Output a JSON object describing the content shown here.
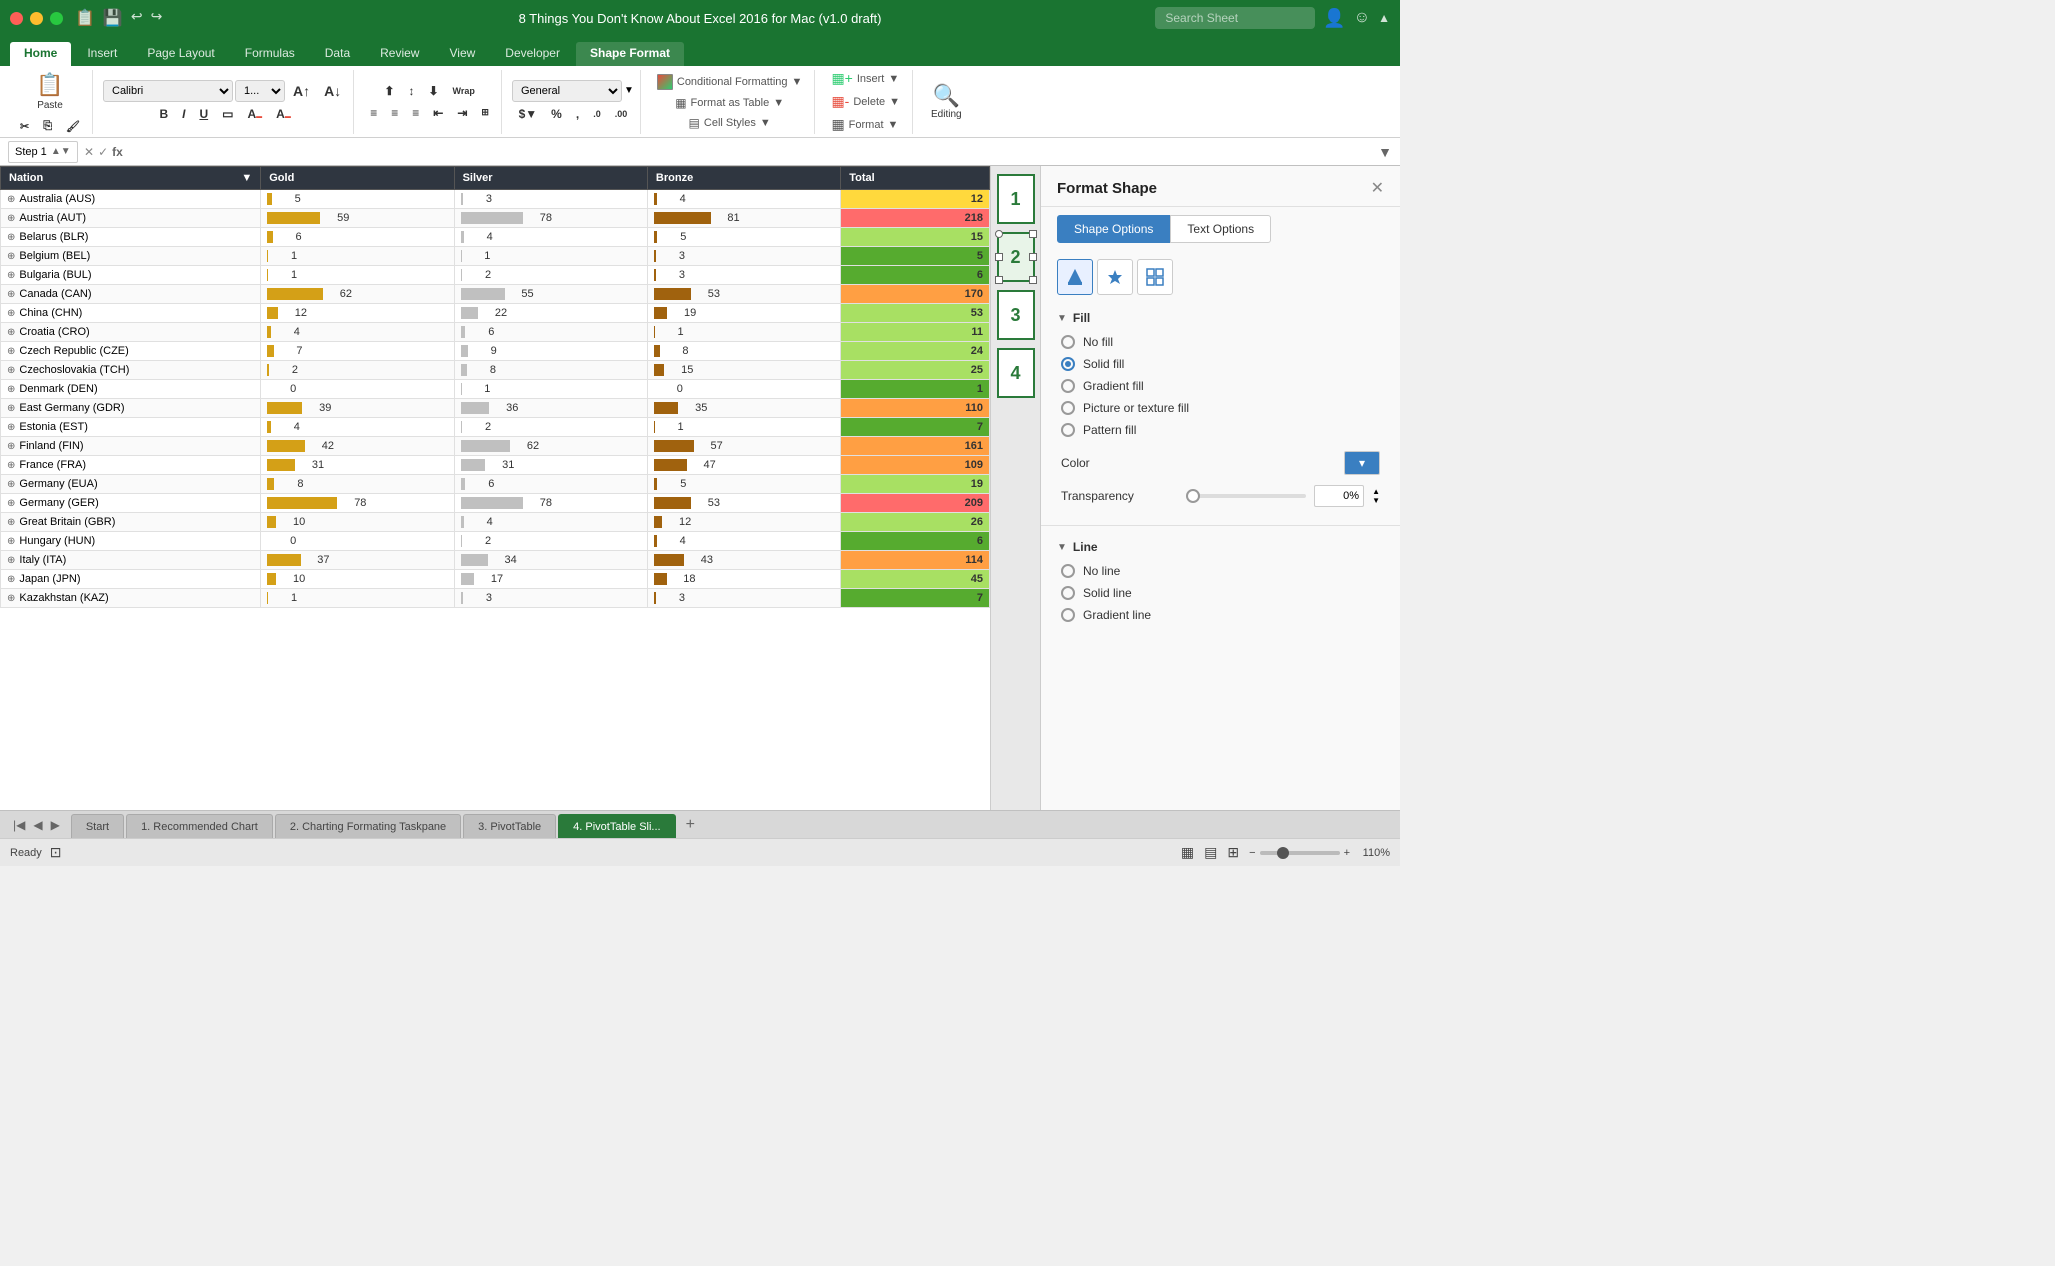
{
  "titlebar": {
    "title": "8 Things You Don't Know About Excel 2016 for Mac (v1.0 draft)",
    "search_placeholder": "Search Sheet",
    "traffic_lights": [
      "red",
      "yellow",
      "green"
    ]
  },
  "ribbon": {
    "tabs": [
      {
        "label": "Home",
        "active": true
      },
      {
        "label": "Insert",
        "active": false
      },
      {
        "label": "Page Layout",
        "active": false
      },
      {
        "label": "Formulas",
        "active": false
      },
      {
        "label": "Data",
        "active": false
      },
      {
        "label": "Review",
        "active": false
      },
      {
        "label": "View",
        "active": false
      },
      {
        "label": "Developer",
        "active": false
      },
      {
        "label": "Shape Format",
        "active": false,
        "special": true
      }
    ],
    "paste_label": "Paste",
    "font_name": "Calibri",
    "font_size": "1...",
    "bold": "B",
    "italic": "I",
    "underline": "U",
    "number_format": "General",
    "conditional_formatting": "Conditional Formatting",
    "format_as_table": "Format as Table",
    "cell_styles": "Cell Styles",
    "insert_label": "Insert",
    "delete_label": "Delete",
    "format_label": "Format",
    "editing_label": "Editing"
  },
  "formula_bar": {
    "name_box": "Step 1",
    "formula": ""
  },
  "table": {
    "headers": [
      "Nation",
      "Gold",
      "Silver",
      "Bronze",
      "Total"
    ],
    "rows": [
      {
        "nation": "Australia (AUS)",
        "gold": 5,
        "gold_bar": 5,
        "silver": 3,
        "silver_bar": 3,
        "bronze": 4,
        "bronze_bar": 4,
        "total": 12,
        "total_class": "total-yellow"
      },
      {
        "nation": "Austria (AUT)",
        "gold": 59,
        "gold_bar": 59,
        "silver": 78,
        "silver_bar": 78,
        "bronze": 81,
        "bronze_bar": 81,
        "total": 218,
        "total_class": "total-red"
      },
      {
        "nation": "Belarus (BLR)",
        "gold": 6,
        "gold_bar": 6,
        "silver": 4,
        "silver_bar": 4,
        "bronze": 5,
        "bronze_bar": 5,
        "total": 15,
        "total_class": "total-lime"
      },
      {
        "nation": "Belgium (BEL)",
        "gold": 1,
        "gold_bar": 1,
        "silver": 1,
        "silver_bar": 1,
        "bronze": 3,
        "bronze_bar": 3,
        "total": 5,
        "total_class": "total-green"
      },
      {
        "nation": "Bulgaria (BUL)",
        "gold": 1,
        "gold_bar": 1,
        "silver": 2,
        "silver_bar": 2,
        "bronze": 3,
        "bronze_bar": 3,
        "total": 6,
        "total_class": "total-green"
      },
      {
        "nation": "Canada (CAN)",
        "gold": 62,
        "gold_bar": 62,
        "silver": 55,
        "silver_bar": 55,
        "bronze": 53,
        "bronze_bar": 53,
        "total": 170,
        "total_class": "total-orange"
      },
      {
        "nation": "China (CHN)",
        "gold": 12,
        "gold_bar": 12,
        "silver": 22,
        "silver_bar": 22,
        "bronze": 19,
        "bronze_bar": 19,
        "total": 53,
        "total_class": "total-lime"
      },
      {
        "nation": "Croatia (CRO)",
        "gold": 4,
        "gold_bar": 4,
        "silver": 6,
        "silver_bar": 6,
        "bronze": 1,
        "bronze_bar": 1,
        "total": 11,
        "total_class": "total-lime"
      },
      {
        "nation": "Czech Republic (CZE)",
        "gold": 7,
        "gold_bar": 7,
        "silver": 9,
        "silver_bar": 9,
        "bronze": 8,
        "bronze_bar": 8,
        "total": 24,
        "total_class": "total-lime"
      },
      {
        "nation": "Czechoslovakia (TCH)",
        "gold": 2,
        "gold_bar": 2,
        "silver": 8,
        "silver_bar": 8,
        "bronze": 15,
        "bronze_bar": 15,
        "total": 25,
        "total_class": "total-lime"
      },
      {
        "nation": "Denmark (DEN)",
        "gold": 0,
        "gold_bar": 0,
        "silver": 1,
        "silver_bar": 1,
        "bronze": 0,
        "bronze_bar": 0,
        "total": 1,
        "total_class": "total-green"
      },
      {
        "nation": "East Germany (GDR)",
        "gold": 39,
        "gold_bar": 39,
        "silver": 36,
        "silver_bar": 36,
        "bronze": 35,
        "bronze_bar": 35,
        "total": 110,
        "total_class": "total-orange"
      },
      {
        "nation": "Estonia (EST)",
        "gold": 4,
        "gold_bar": 4,
        "silver": 2,
        "silver_bar": 2,
        "bronze": 1,
        "bronze_bar": 1,
        "total": 7,
        "total_class": "total-green"
      },
      {
        "nation": "Finland (FIN)",
        "gold": 42,
        "gold_bar": 42,
        "silver": 62,
        "silver_bar": 62,
        "bronze": 57,
        "bronze_bar": 57,
        "total": 161,
        "total_class": "total-orange"
      },
      {
        "nation": "France (FRA)",
        "gold": 31,
        "gold_bar": 31,
        "silver": 31,
        "silver_bar": 31,
        "bronze": 47,
        "bronze_bar": 47,
        "total": 109,
        "total_class": "total-orange"
      },
      {
        "nation": "Germany (EUA)",
        "gold": 8,
        "gold_bar": 8,
        "silver": 6,
        "silver_bar": 6,
        "bronze": 5,
        "bronze_bar": 5,
        "total": 19,
        "total_class": "total-lime"
      },
      {
        "nation": "Germany (GER)",
        "gold": 78,
        "gold_bar": 78,
        "silver": 78,
        "silver_bar": 78,
        "bronze": 53,
        "bronze_bar": 53,
        "total": 209,
        "total_class": "total-red"
      },
      {
        "nation": "Great Britain (GBR)",
        "gold": 10,
        "gold_bar": 10,
        "silver": 4,
        "silver_bar": 4,
        "bronze": 12,
        "bronze_bar": 12,
        "total": 26,
        "total_class": "total-lime"
      },
      {
        "nation": "Hungary (HUN)",
        "gold": 0,
        "gold_bar": 0,
        "silver": 2,
        "silver_bar": 2,
        "bronze": 4,
        "bronze_bar": 4,
        "total": 6,
        "total_class": "total-green"
      },
      {
        "nation": "Italy (ITA)",
        "gold": 37,
        "gold_bar": 37,
        "silver": 34,
        "silver_bar": 34,
        "bronze": 43,
        "bronze_bar": 43,
        "total": 114,
        "total_class": "total-orange"
      },
      {
        "nation": "Japan (JPN)",
        "gold": 10,
        "gold_bar": 10,
        "silver": 17,
        "silver_bar": 17,
        "bronze": 18,
        "bronze_bar": 18,
        "total": 45,
        "total_class": "total-lime"
      },
      {
        "nation": "Kazakhstan (KAZ)",
        "gold": 1,
        "gold_bar": 1,
        "silver": 3,
        "silver_bar": 3,
        "bronze": 3,
        "bronze_bar": 3,
        "total": 7,
        "total_class": "total-green"
      }
    ]
  },
  "shape_numbers": [
    "1",
    "2",
    "3",
    "4"
  ],
  "format_panel": {
    "title": "Format Shape",
    "close_icon": "✕",
    "tab_shape_options": "Shape Options",
    "tab_text_options": "Text Options",
    "fill_section": "Fill",
    "fill_options": [
      {
        "label": "No fill",
        "checked": false
      },
      {
        "label": "Solid fill",
        "checked": true
      },
      {
        "label": "Gradient fill",
        "checked": false
      },
      {
        "label": "Picture or texture fill",
        "checked": false
      },
      {
        "label": "Pattern fill",
        "checked": false
      }
    ],
    "color_label": "Color",
    "transparency_label": "Transparency",
    "transparency_value": "0%",
    "line_section": "Line",
    "line_options": [
      {
        "label": "No line",
        "checked": false
      },
      {
        "label": "Solid line",
        "checked": false
      },
      {
        "label": "Gradient line",
        "checked": false
      }
    ]
  },
  "sheet_tabs": [
    {
      "label": "Start",
      "active": false
    },
    {
      "label": "1. Recommended Chart",
      "active": false
    },
    {
      "label": "2. Charting Formating Taskpane",
      "active": false
    },
    {
      "label": "3. PivotTable",
      "active": false
    },
    {
      "label": "4. PivotTable Sli...",
      "active": true
    }
  ],
  "status_bar": {
    "ready": "Ready",
    "zoom": "110%"
  }
}
